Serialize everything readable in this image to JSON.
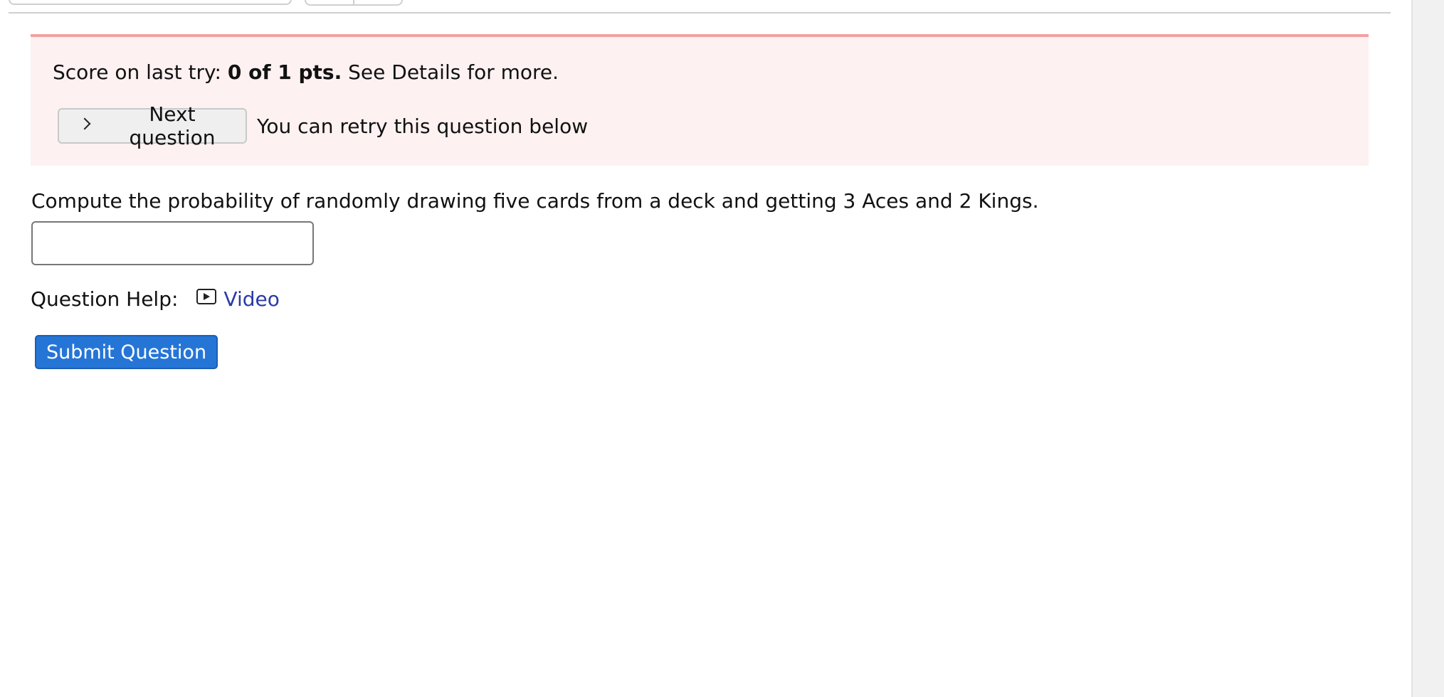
{
  "colors": {
    "banner_background": "#fdf1f1",
    "banner_border": "#f4a0a0",
    "link": "#2a3aa8",
    "primary_button": "#2575d6"
  },
  "feedback": {
    "score_prefix": "Score on last try: ",
    "score_value": "0 of 1 pts.",
    "score_suffix": " See Details for more.",
    "next_button_label": "Next question",
    "next_button_icon": "chevron-right-icon",
    "retry_text": "You can retry this question below"
  },
  "question": {
    "prompt": "Compute the probability of randomly drawing five cards from a deck and getting 3 Aces and 2 Kings.",
    "answer_value": ""
  },
  "help": {
    "label": "Question Help:",
    "video_icon": "video-icon",
    "video_link": "Video"
  },
  "actions": {
    "submit_label": "Submit Question"
  }
}
